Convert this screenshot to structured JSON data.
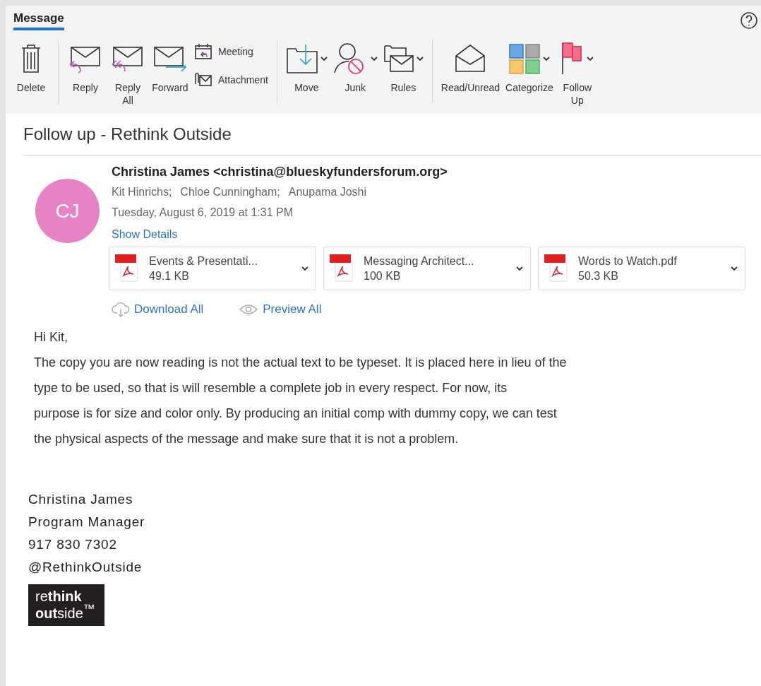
{
  "ribbon": {
    "tabs": [
      {
        "label": "Message",
        "selected": true
      }
    ],
    "groups": [
      {
        "items": [
          {
            "kind": "large",
            "label": "Delete",
            "dropdown": false
          }
        ]
      },
      {
        "items": [
          {
            "kind": "large",
            "label": "Reply",
            "dropdown": false
          },
          {
            "kind": "large",
            "label": "Reply All",
            "dropdown": false
          },
          {
            "kind": "large",
            "label": "Forward",
            "dropdown": false
          },
          {
            "kind": "small",
            "label": "Meeting",
            "dropdown": false
          },
          {
            "kind": "small",
            "label": "Attachment",
            "dropdown": false
          }
        ]
      },
      {
        "items": [
          {
            "kind": "large",
            "label": "Move",
            "dropdown": true
          },
          {
            "kind": "large",
            "label": "Junk",
            "dropdown": true
          },
          {
            "kind": "large",
            "label": "Rules",
            "dropdown": true
          }
        ]
      },
      {
        "items": [
          {
            "kind": "large",
            "label": "Read/Unread",
            "dropdown": false
          },
          {
            "kind": "large",
            "label": "Categorize",
            "dropdown": true
          },
          {
            "kind": "large",
            "label": "Follow Up",
            "dropdown": true
          }
        ]
      }
    ]
  },
  "message": {
    "subject": "Follow up - Rethink Outside",
    "avatar": {
      "initials": "CJ",
      "color": "#e683c4"
    },
    "sender": "Christina James <christina@blueskyfundersforum.org>",
    "recipients": [
      "Kit Hinrichs;",
      "Chloe Cunningham;",
      "Anupama Joshi"
    ],
    "date": "Tuesday, August 6, 2019 at 1:31 PM",
    "details_link": "Show Details",
    "attachments": [
      {
        "name": "Events & Presentati...",
        "size": "49.1 KB"
      },
      {
        "name": "Messaging Architect...",
        "size": "100 KB"
      },
      {
        "name": "Words to Watch.pdf",
        "size": "50.3 KB"
      }
    ],
    "actions": [
      "Download All",
      "Preview All"
    ],
    "greeting": "Hi Kit,",
    "body": [
      "The copy you are now reading is not the actual text to be typeset. It is placed here in lieu of the",
      "type to be used, so that is will resemble a complete job in every respect. For now, its",
      "purpose is for size and color only. By producing an initial comp with dummy copy, we can test",
      "the physical aspects of the message and make sure that it is not a problem."
    ],
    "signature": [
      "Christina James",
      "Program Manager",
      "917 830 7302",
      "@RethinkOutside"
    ],
    "logo": [
      "re**think**",
      "**out**side$^{™}$"
    ]
  }
}
